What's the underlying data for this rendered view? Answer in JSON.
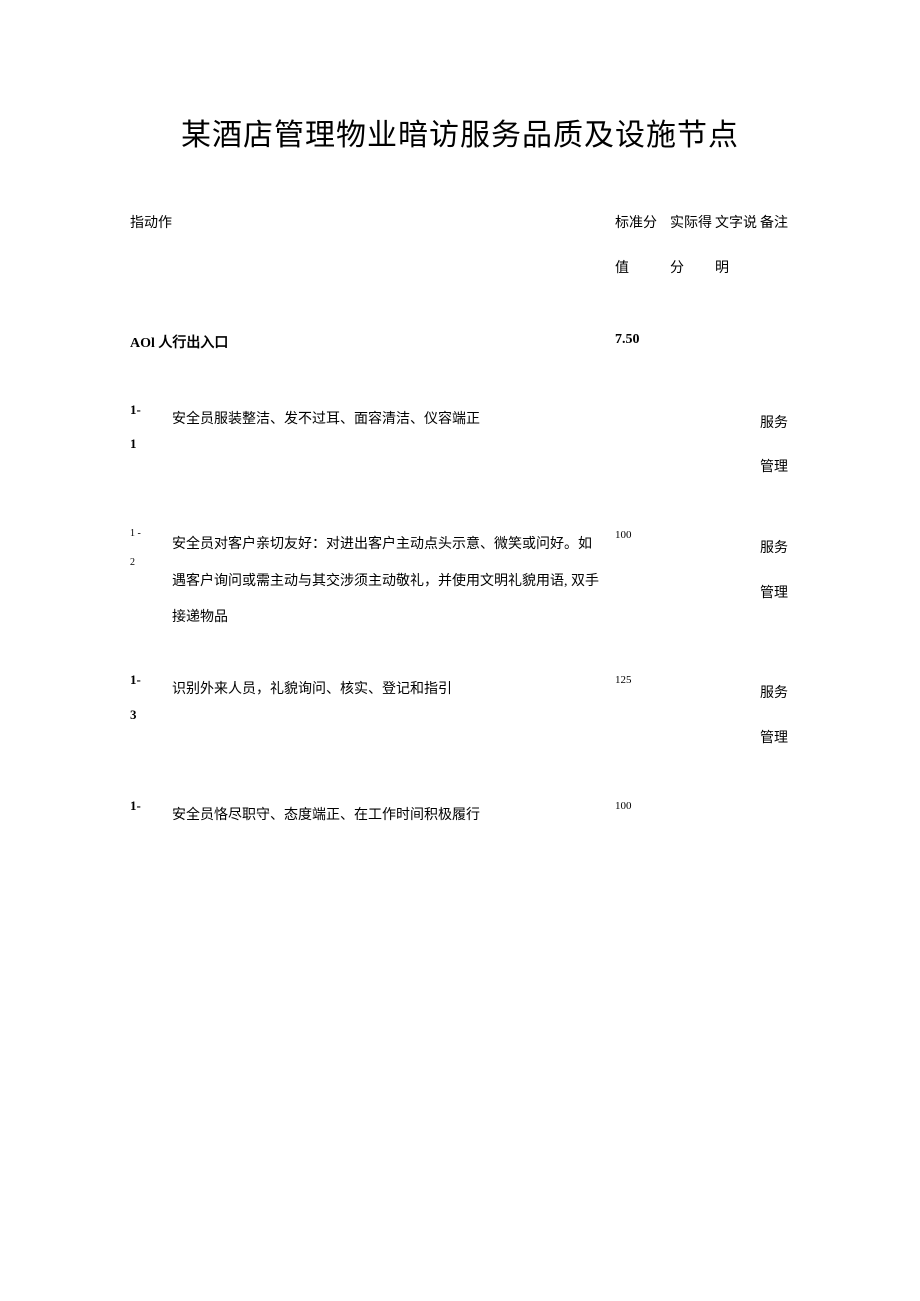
{
  "title": "某酒店管理物业暗访服务品质及设施节点",
  "headers": {
    "idx": "指动作",
    "score": "标准分值",
    "actual": "实际得分",
    "text": "文字说明",
    "remark": "备注"
  },
  "section": {
    "title": "AOl 人行出入口",
    "score": "7.50"
  },
  "rows": [
    {
      "idx1": "1-",
      "idx2": "1",
      "desc": "安全员服装整洁、发不过耳、面容清洁、仪容端正",
      "score": "",
      "remark": "服务管理"
    },
    {
      "idx1": "1 -",
      "idx2": "2",
      "desc": "安全员对客户亲切友好：对进出客户主动点头示意、微笑或问好。如遇客户询问或需主动与其交涉须主动敬礼，并使用文明礼貌用语, 双手接递物品",
      "score": "100",
      "remark": "服务管理"
    },
    {
      "idx1": "1-",
      "idx2": "3",
      "desc": "识别外来人员，礼貌询问、核实、登记和指引",
      "score": "125",
      "remark": "服务管理"
    },
    {
      "idx1": "1-",
      "idx2": "",
      "desc": "安全员恪尽职守、态度端正、在工作时间积极履行",
      "score": "100",
      "remark": ""
    }
  ]
}
